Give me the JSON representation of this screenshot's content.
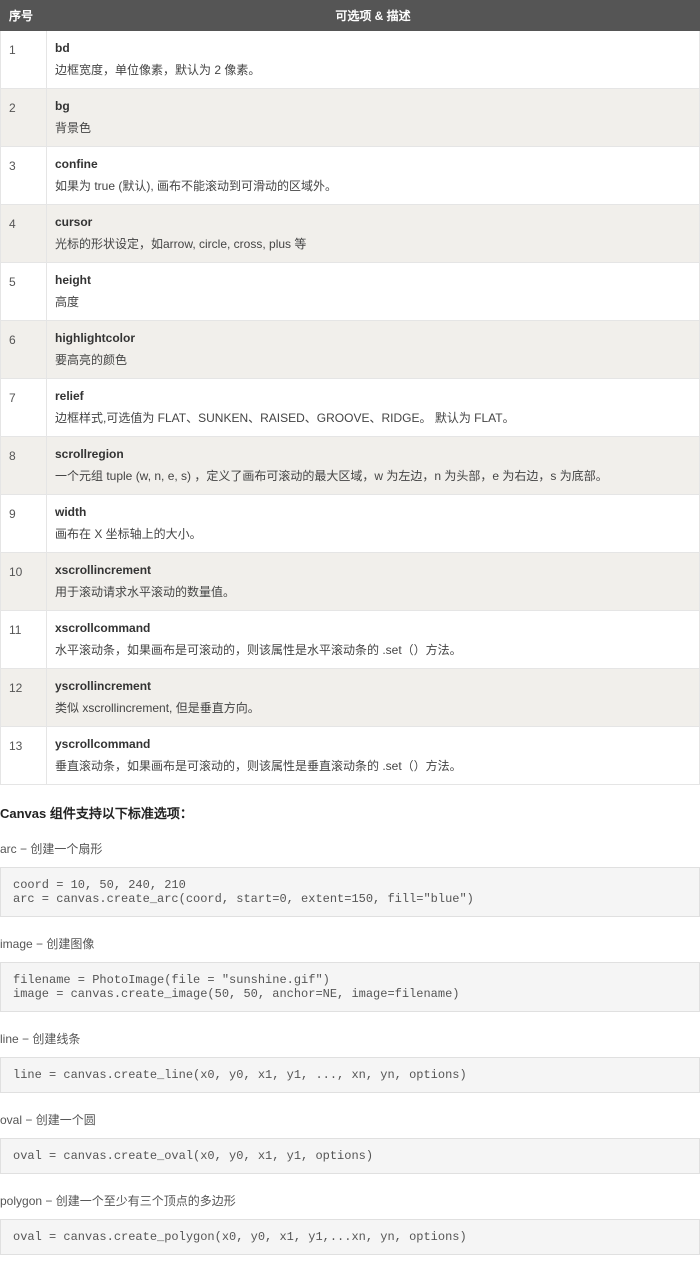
{
  "table": {
    "headers": {
      "col1": "序号",
      "col2": "可选项 & 描述"
    },
    "rows": [
      {
        "n": "1",
        "name": "bd",
        "desc": "边框宽度，单位像素，默认为 2 像素。"
      },
      {
        "n": "2",
        "name": "bg",
        "desc": "背景色"
      },
      {
        "n": "3",
        "name": "confine",
        "desc": "如果为 true (默认), 画布不能滚动到可滑动的区域外。"
      },
      {
        "n": "4",
        "name": "cursor",
        "desc": "光标的形状设定，如arrow, circle, cross, plus 等"
      },
      {
        "n": "5",
        "name": "height",
        "desc": "高度"
      },
      {
        "n": "6",
        "name": "highlightcolor",
        "desc": "要高亮的颜色"
      },
      {
        "n": "7",
        "name": "relief",
        "desc": "边框样式,可选值为 FLAT、SUNKEN、RAISED、GROOVE、RIDGE。 默认为 FLAT。"
      },
      {
        "n": "8",
        "name": "scrollregion",
        "desc": "一个元组 tuple (w, n, e, s) ，定义了画布可滚动的最大区域，w 为左边，n 为头部，e 为右边，s 为底部。"
      },
      {
        "n": "9",
        "name": "width",
        "desc": "画布在 X 坐标轴上的大小。"
      },
      {
        "n": "10",
        "name": "xscrollincrement",
        "desc": "用于滚动请求水平滚动的数量值。"
      },
      {
        "n": "11",
        "name": "xscrollcommand",
        "desc": "水平滚动条，如果画布是可滚动的，则该属性是水平滚动条的 .set（）方法。"
      },
      {
        "n": "12",
        "name": "yscrollincrement",
        "desc": "类似 xscrollincrement, 但是垂直方向。"
      },
      {
        "n": "13",
        "name": "yscrollcommand",
        "desc": "垂直滚动条，如果画布是可滚动的，则该属性是垂直滚动条的 .set（）方法。"
      }
    ]
  },
  "section_heading": "Canvas 组件支持以下标准选项：",
  "items": [
    {
      "label": "arc − 创建一个扇形",
      "code": "coord = 10, 50, 240, 210\narc = canvas.create_arc(coord, start=0, extent=150, fill=\"blue\")"
    },
    {
      "label": "image − 创建图像",
      "code": "filename = PhotoImage(file = \"sunshine.gif\")\nimage = canvas.create_image(50, 50, anchor=NE, image=filename)"
    },
    {
      "label": "line − 创建线条",
      "code": "line = canvas.create_line(x0, y0, x1, y1, ..., xn, yn, options)"
    },
    {
      "label": "oval − 创建一个圆",
      "code": "oval = canvas.create_oval(x0, y0, x1, y1, options)"
    },
    {
      "label": "polygon − 创建一个至少有三个顶点的多边形",
      "code": "oval = canvas.create_polygon(x0, y0, x1, y1,...xn, yn, options)"
    }
  ]
}
